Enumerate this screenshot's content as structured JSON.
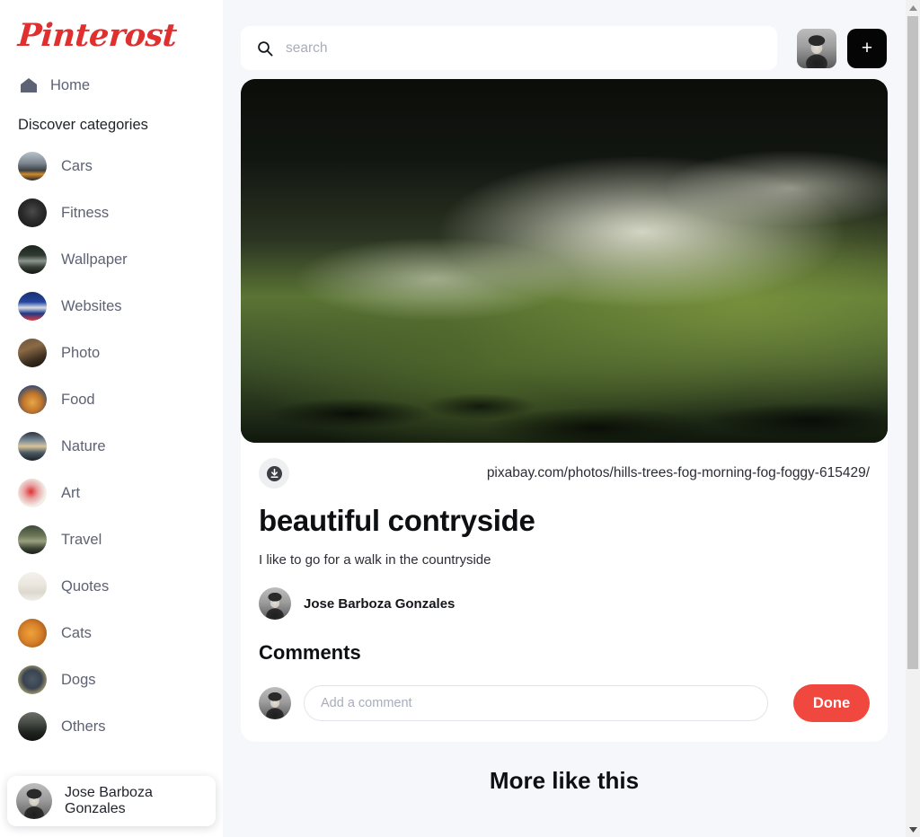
{
  "app": {
    "logo_text": "Pinterost",
    "brand_color": "#e02f2f",
    "accent_color": "#f0483f",
    "page_background": "#f6f7fa"
  },
  "sidebar": {
    "home": {
      "label": "Home",
      "icon": "home-icon"
    },
    "discover_title": "Discover categories",
    "categories": [
      {
        "label": "Cars",
        "thumb": "ph-cars"
      },
      {
        "label": "Fitness",
        "thumb": "ph-fitness"
      },
      {
        "label": "Wallpaper",
        "thumb": "ph-wall"
      },
      {
        "label": "Websites",
        "thumb": "ph-web"
      },
      {
        "label": "Photo",
        "thumb": "ph-photo"
      },
      {
        "label": "Food",
        "thumb": "ph-food"
      },
      {
        "label": "Nature",
        "thumb": "ph-nature"
      },
      {
        "label": "Art",
        "thumb": "ph-art"
      },
      {
        "label": "Travel",
        "thumb": "ph-travel"
      },
      {
        "label": "Quotes",
        "thumb": "ph-quotes"
      },
      {
        "label": "Cats",
        "thumb": "ph-cats"
      },
      {
        "label": "Dogs",
        "thumb": "ph-dogs"
      },
      {
        "label": "Others",
        "thumb": "ph-others"
      }
    ],
    "user": {
      "name": "Jose Barboza Gonzales",
      "avatar": "portrait-photo"
    }
  },
  "topbar": {
    "search_placeholder": "search",
    "search_value": "",
    "search_icon": "search-icon",
    "avatar": "portrait-photo",
    "add_button_label": "+"
  },
  "pin": {
    "image_alt": "hills trees fog morning photo",
    "download_icon": "download-icon",
    "source_url": "pixabay.com/photos/hills-trees-fog-morning-fog-foggy-615429/",
    "title": "beautiful contryside",
    "description": "I like to go for a walk in the countryside",
    "author": {
      "name": "Jose Barboza Gonzales",
      "avatar": "portrait-photo"
    }
  },
  "comments": {
    "heading": "Comments",
    "input_placeholder": "Add a comment",
    "input_value": "",
    "submit_label": "Done",
    "avatar": "portrait-photo"
  },
  "more": {
    "heading": "More like this"
  },
  "scrollbar": {
    "up_icon": "chevron-up-icon",
    "down_icon": "chevron-down-icon"
  }
}
